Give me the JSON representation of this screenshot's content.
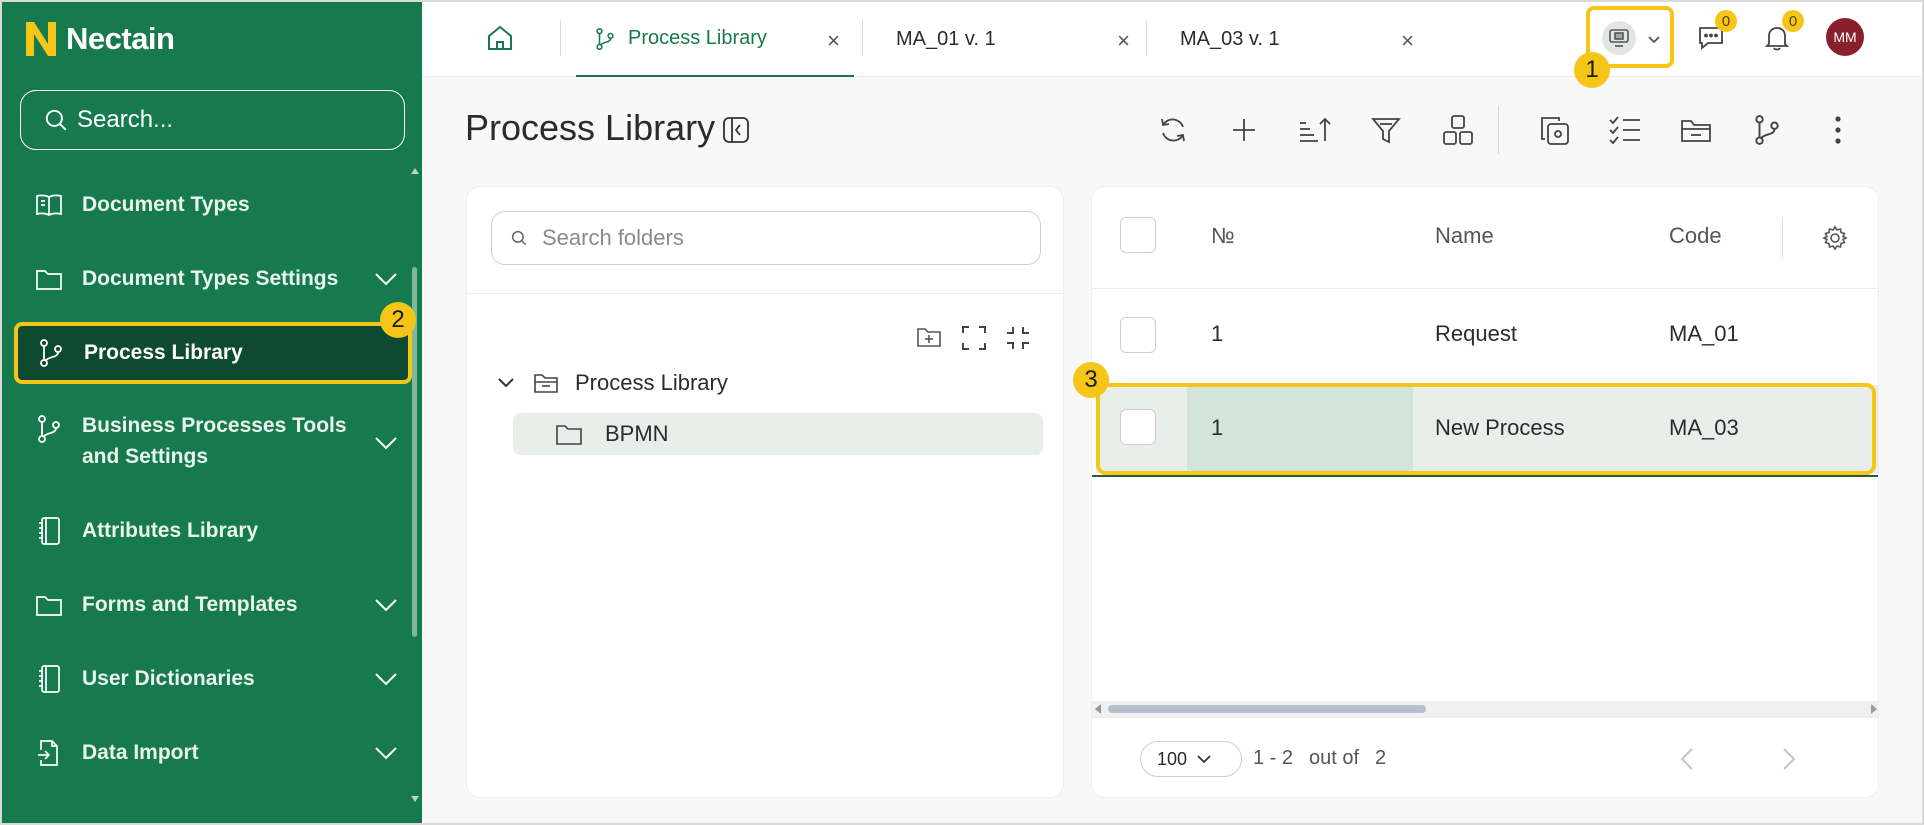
{
  "brand": {
    "name": "Nectain",
    "color": "#177a4e",
    "accent": "#f5c518"
  },
  "sidebar": {
    "search_placeholder": "Search...",
    "items": [
      {
        "label": "Document Types",
        "icon": "book-open-icon",
        "has_children": false
      },
      {
        "label": "Document Types Settings",
        "icon": "folder-icon",
        "has_children": true
      },
      {
        "label": "Process Library",
        "icon": "git-branch-icon",
        "has_children": false,
        "active": true
      },
      {
        "label": "Business Processes Tools",
        "label2": "and Settings",
        "icon": "git-branch-icon",
        "has_children": true
      },
      {
        "label": "Attributes Library",
        "icon": "notebook-icon",
        "has_children": false
      },
      {
        "label": "Forms and Templates",
        "icon": "folder-icon",
        "has_children": true
      },
      {
        "label": "User Dictionaries",
        "icon": "notebook-icon",
        "has_children": true
      },
      {
        "label": "Data Import",
        "icon": "file-import-icon",
        "has_children": true
      }
    ]
  },
  "tabs": [
    {
      "label": "Process Library",
      "active": true
    },
    {
      "label": "MA_01 v. 1",
      "active": false
    },
    {
      "label": "MA_03 v. 1",
      "active": false
    }
  ],
  "header": {
    "messages_count": "0",
    "notifications_count": "0",
    "avatar_initials": "MM"
  },
  "markers": {
    "one": "1",
    "two": "2",
    "three": "3"
  },
  "page": {
    "title": "Process Library"
  },
  "folders": {
    "search_placeholder": "Search folders",
    "root": "Process Library",
    "child": "BPMN"
  },
  "table": {
    "columns": {
      "num": "№",
      "name": "Name",
      "code": "Code"
    },
    "rows": [
      {
        "num": "1",
        "name": "Request",
        "code": "MA_01"
      },
      {
        "num": "1",
        "name": "New Process",
        "code": "MA_03"
      }
    ],
    "page_size": "100",
    "range": "1 - 2",
    "out_of_label": "out of",
    "total": "2"
  }
}
